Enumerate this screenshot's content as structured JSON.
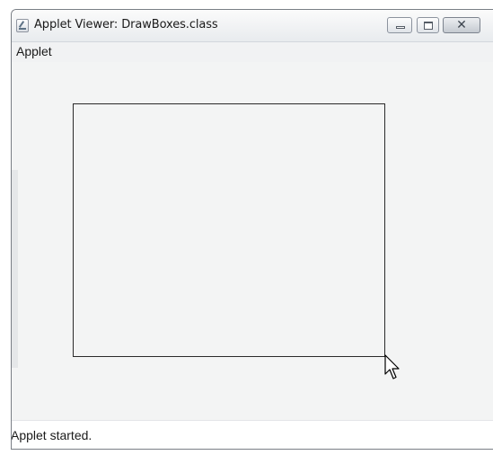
{
  "window": {
    "title": "Applet Viewer: DrawBoxes.class",
    "icon": "java-applet-icon",
    "controls": {
      "minimize_icon": "minimize-icon",
      "maximize_icon": "maximize-icon",
      "close_icon": "close-icon",
      "close_glyph": "✕"
    }
  },
  "menubar": {
    "items": [
      {
        "label": "Applet"
      }
    ]
  },
  "canvas": {
    "shape": "rectangle",
    "cursor_icon": "mouse-pointer-icon"
  },
  "status": {
    "text": "Applet started."
  }
}
